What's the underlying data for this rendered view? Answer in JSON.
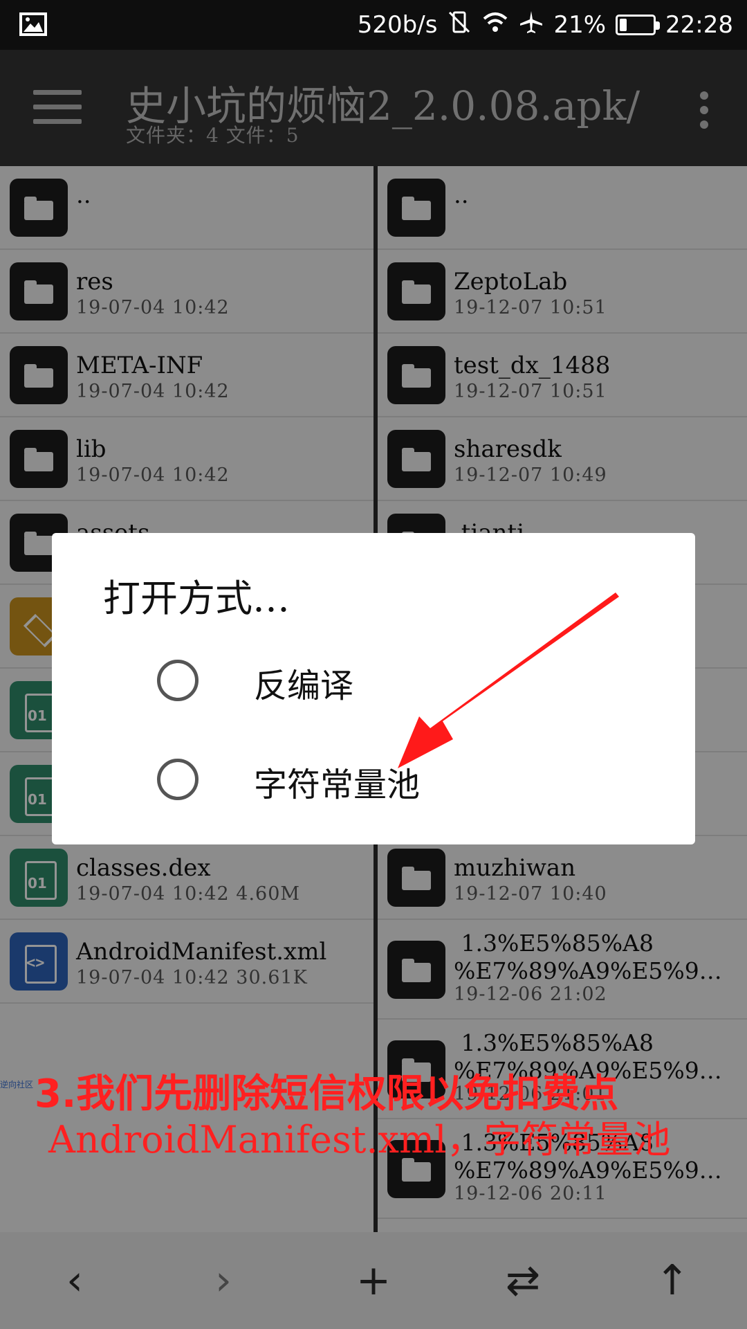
{
  "status": {
    "net_speed": "520b/s",
    "battery": "21%",
    "battery_level": 0.21,
    "time": "22:28"
  },
  "toolbar": {
    "title": "史小坑的烦恼2_2.0.08.apk/",
    "subtitle": "文件夹：4  文件：5"
  },
  "left_pane": [
    {
      "name": "..",
      "meta": "",
      "icon": "folder-icon"
    },
    {
      "name": "res",
      "meta": "19-07-04 10:42",
      "icon": "folder-icon"
    },
    {
      "name": "META-INF",
      "meta": "19-07-04 10:42",
      "icon": "folder-icon"
    },
    {
      "name": "lib",
      "meta": "19-07-04 10:42",
      "icon": "folder-icon"
    },
    {
      "name": "assets",
      "meta": "",
      "icon": "folder-icon"
    },
    {
      "name": "",
      "meta": "",
      "icon": "layers-icon"
    },
    {
      "name": "",
      "meta": "",
      "icon": "dex-file-icon"
    },
    {
      "name": "",
      "meta": "",
      "icon": "dex-file-icon"
    },
    {
      "name": "classes.dex",
      "meta": "19-07-04 10:42  4.60M",
      "icon": "dex-file-icon"
    },
    {
      "name": "AndroidManifest.xml",
      "meta": "19-07-04 10:42  30.61K",
      "icon": "xml-file-icon"
    }
  ],
  "watermark": "逆向社区",
  "right_pane": [
    {
      "name": "..",
      "meta": ""
    },
    {
      "name": "ZeptoLab",
      "meta": "19-12-07 10:51"
    },
    {
      "name": "test_dx_1488",
      "meta": "19-12-07 10:51"
    },
    {
      "name": "sharesdk",
      "meta": "19-12-07 10:49"
    },
    {
      "name": ".tianti",
      "meta": ""
    },
    {
      "name": "",
      "meta": ""
    },
    {
      "name": "",
      "meta": ""
    },
    {
      "name": "",
      "meta": ""
    },
    {
      "name": "muzhiwan",
      "meta": "19-12-07 10:40"
    }
  ],
  "right_pane_tall": [
    {
      "name": " 1.3%E5%85%A8\n%E7%89%A9%E5%9…",
      "meta": "19-12-06 21:02"
    },
    {
      "name": " 1.3%E5%85%A8\n%E7%89%A9%E5%9…",
      "meta": "19-12-06 21:01"
    },
    {
      "name": " 1.3%E5%85%A8\n%E7%89%A9%E5%9…",
      "meta": "19-12-06 20:11"
    }
  ],
  "dialog": {
    "title": "打开方式…",
    "options": [
      {
        "label": "反编译"
      },
      {
        "label": "字符常量池"
      }
    ]
  },
  "annotation": {
    "line1": "3.我们先删除短信权限以免扣费点",
    "line2": "AndroidManifest.xml，字符常量池",
    "color": "#ff2020"
  },
  "bottom_bar": {
    "back": "‹",
    "forward": "›",
    "add": "+",
    "swap": "⇄",
    "up": "↑"
  }
}
